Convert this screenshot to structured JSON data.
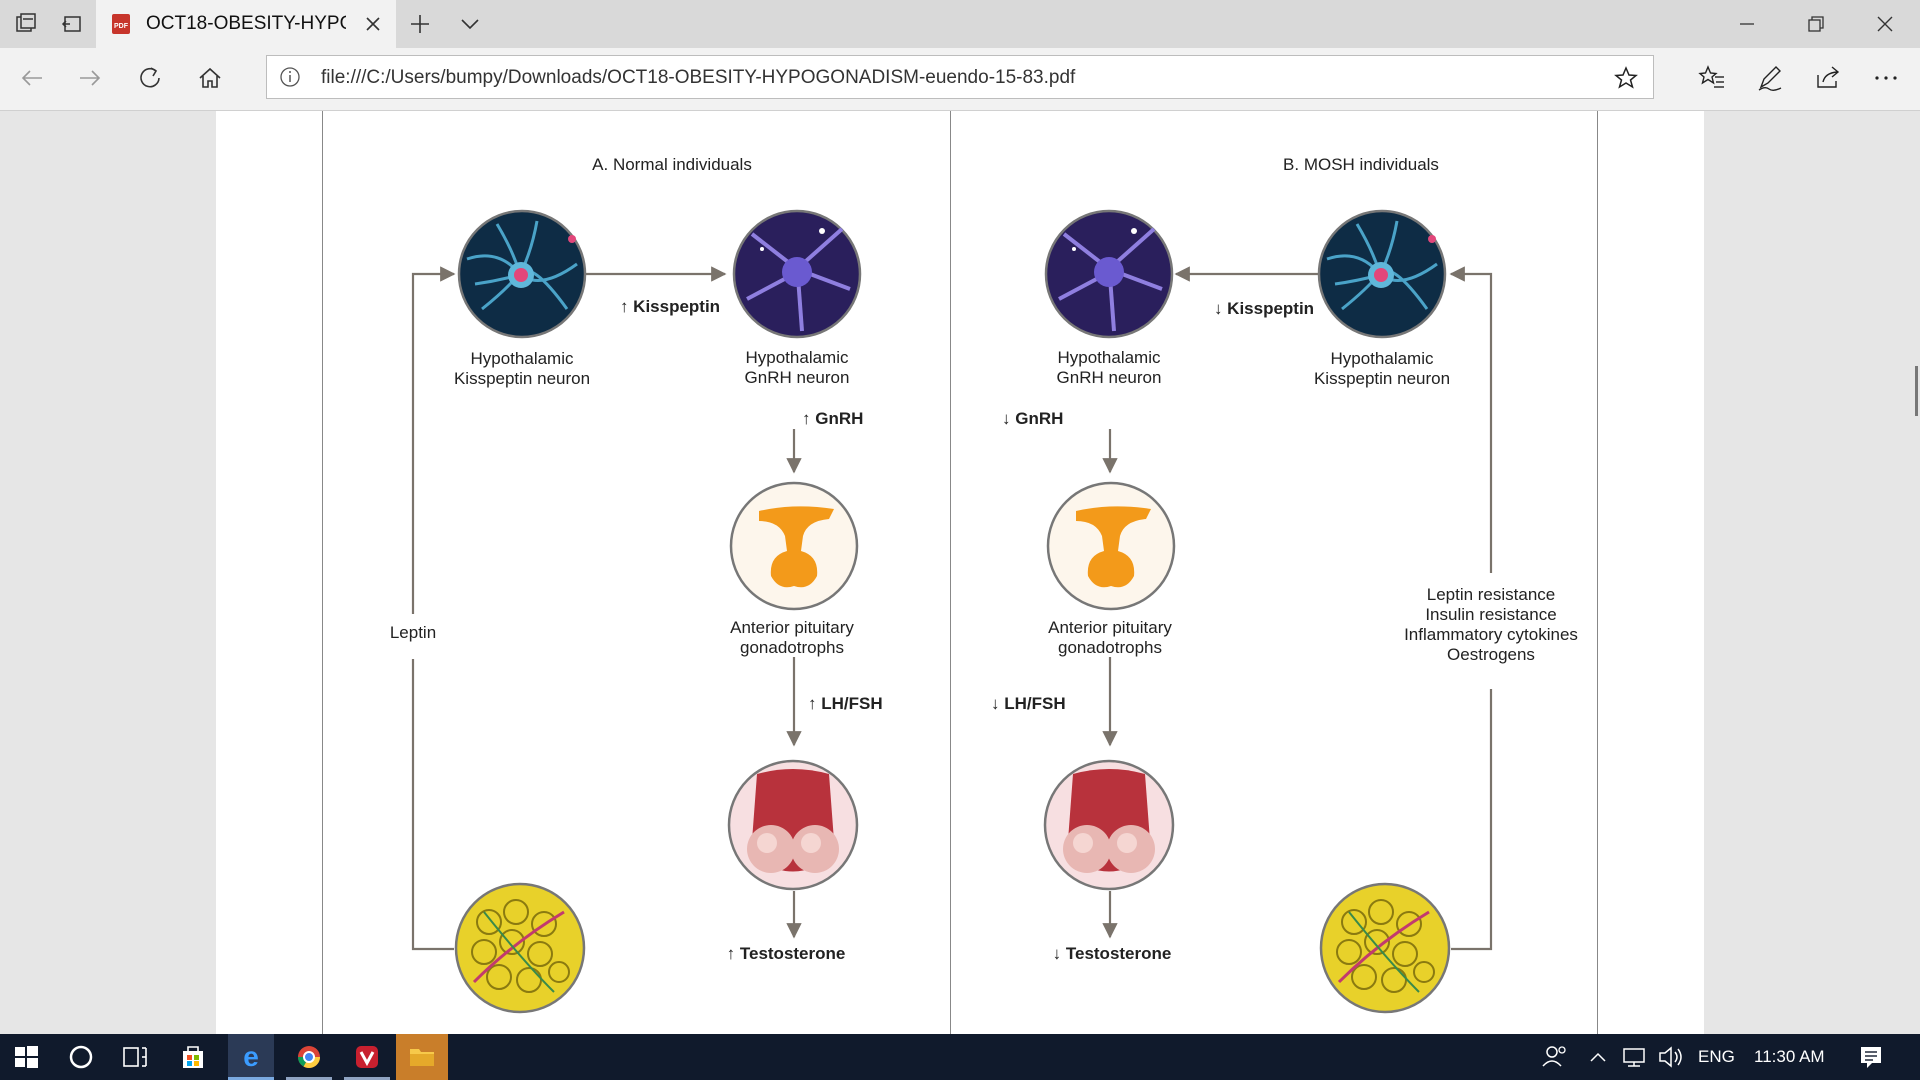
{
  "browser": {
    "tab_title": "OCT18-OBESITY-HYPO(",
    "url": "file:///C:/Users/bumpy/Downloads/OCT18-OBESITY-HYPOGONADISM-euendo-15-83.pdf"
  },
  "figure": {
    "panel_a": {
      "heading": "A. Normal individuals",
      "kiss_neuron": [
        "Hypothalamic",
        "Kisspeptin neuron"
      ],
      "kisspeptin": "↑ Kisspeptin",
      "gnrh_neuron": [
        "Hypothalamic",
        "GnRH neuron"
      ],
      "gnrh": "↑ GnRH",
      "pituitary": [
        "Anterior pituitary",
        "gonadotrophs"
      ],
      "lhfsh": "↑ LH/FSH",
      "testosterone": "↑ Testosterone",
      "leptin": "Leptin"
    },
    "panel_b": {
      "heading": "B. MOSH individuals",
      "gnrh_neuron": [
        "Hypothalamic",
        "GnRH neuron"
      ],
      "kisspeptin": "↓ Kisspeptin",
      "kiss_neuron": [
        "Hypothalamic",
        "Kisspeptin neuron"
      ],
      "gnrh": "↓ GnRH",
      "pituitary": [
        "Anterior pituitary",
        "gonadotrophs"
      ],
      "lhfsh": "↓ LH/FSH",
      "testosterone": "↓  Testosterone",
      "factors": [
        "Leptin resistance",
        "Insulin resistance",
        "Inflammatory cytokines",
        "Oestrogens"
      ]
    }
  },
  "taskbar": {
    "language": "ENG",
    "time": "11:30 AM"
  },
  "colors": {
    "taskbar_bg": "#101a2c",
    "arrow": "#7a736b",
    "neuron_blue": "#4aa3c8",
    "neuron_purple": "#5b4aa8",
    "gland_orange": "#f39a1a",
    "testes_red": "#b8323c",
    "fat_yellow": "#e8d12a"
  }
}
